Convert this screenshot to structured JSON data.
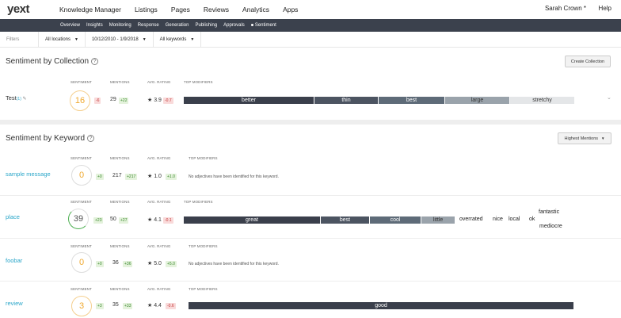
{
  "logo": "yext",
  "nav": [
    "Knowledge Manager",
    "Listings",
    "Pages",
    "Reviews",
    "Analytics",
    "Apps"
  ],
  "user": "Sarah Crown *",
  "help": "Help",
  "subnav": [
    "Overview",
    "Insights",
    "Monitoring",
    "Response",
    "Generation",
    "Publishing",
    "Approvals",
    "Sentiment"
  ],
  "filters": {
    "label": "Filters",
    "locations": "All locations",
    "dates": "10/12/2010 - 1/9/2018",
    "keywords": "All keywords"
  },
  "collection": {
    "title": "Sentiment by Collection",
    "create_button": "Create Collection",
    "headers": [
      "SENTIMENT",
      "MENTIONS",
      "AVG. RATING",
      "TOP MODIFIERS"
    ],
    "row": {
      "name": "Test",
      "name_suffix": "(1)",
      "sentiment": "16",
      "sentiment_delta": "-6",
      "mentions": "29",
      "mentions_delta": "+22",
      "rating": "★ 3.9",
      "rating_delta": "-0.7",
      "modifiers": [
        "better",
        "thin",
        "best",
        "large",
        "stretchy"
      ]
    }
  },
  "keyword": {
    "title": "Sentiment by Keyword",
    "sort_button": "Highest Mentions",
    "headers": [
      "SENTIMENT",
      "MENTIONS",
      "AVG. RATING",
      "TOP MODIFIERS"
    ],
    "no_modifiers": "No adjectives have been identified for this keyword.",
    "rows": [
      {
        "name": "sample message",
        "sentiment": "0",
        "sentiment_delta": "+0",
        "mentions": "217",
        "mentions_delta": "+217",
        "rating": "★ 1.0",
        "rating_delta": "+1.0"
      },
      {
        "name": "place",
        "sentiment": "39",
        "sentiment_delta": "+23",
        "mentions": "50",
        "mentions_delta": "+27",
        "rating": "★ 4.1",
        "rating_delta": "-0.1",
        "modifiers": [
          "great",
          "best",
          "cool",
          "little",
          "overrated",
          "nice",
          "local",
          "ok",
          "fantastic",
          "mediocre"
        ]
      },
      {
        "name": "foobar",
        "sentiment": "0",
        "sentiment_delta": "+0",
        "mentions": "36",
        "mentions_delta": "+36",
        "rating": "★ 5.0",
        "rating_delta": "+5.0"
      },
      {
        "name": "review",
        "sentiment": "3",
        "sentiment_delta": "+3",
        "mentions": "35",
        "mentions_delta": "+33",
        "rating": "★ 4.4",
        "rating_delta": "-0.6",
        "modifiers": [
          "good"
        ]
      }
    ]
  },
  "colors": {
    "accent": "#2aa6c9",
    "nav_dark": "#3b414d",
    "bar_dark": "#3a3f4b",
    "bar_mid": "#5e6b78",
    "bar_light": "#9aa3ab",
    "sentiment": "#f0a930"
  }
}
